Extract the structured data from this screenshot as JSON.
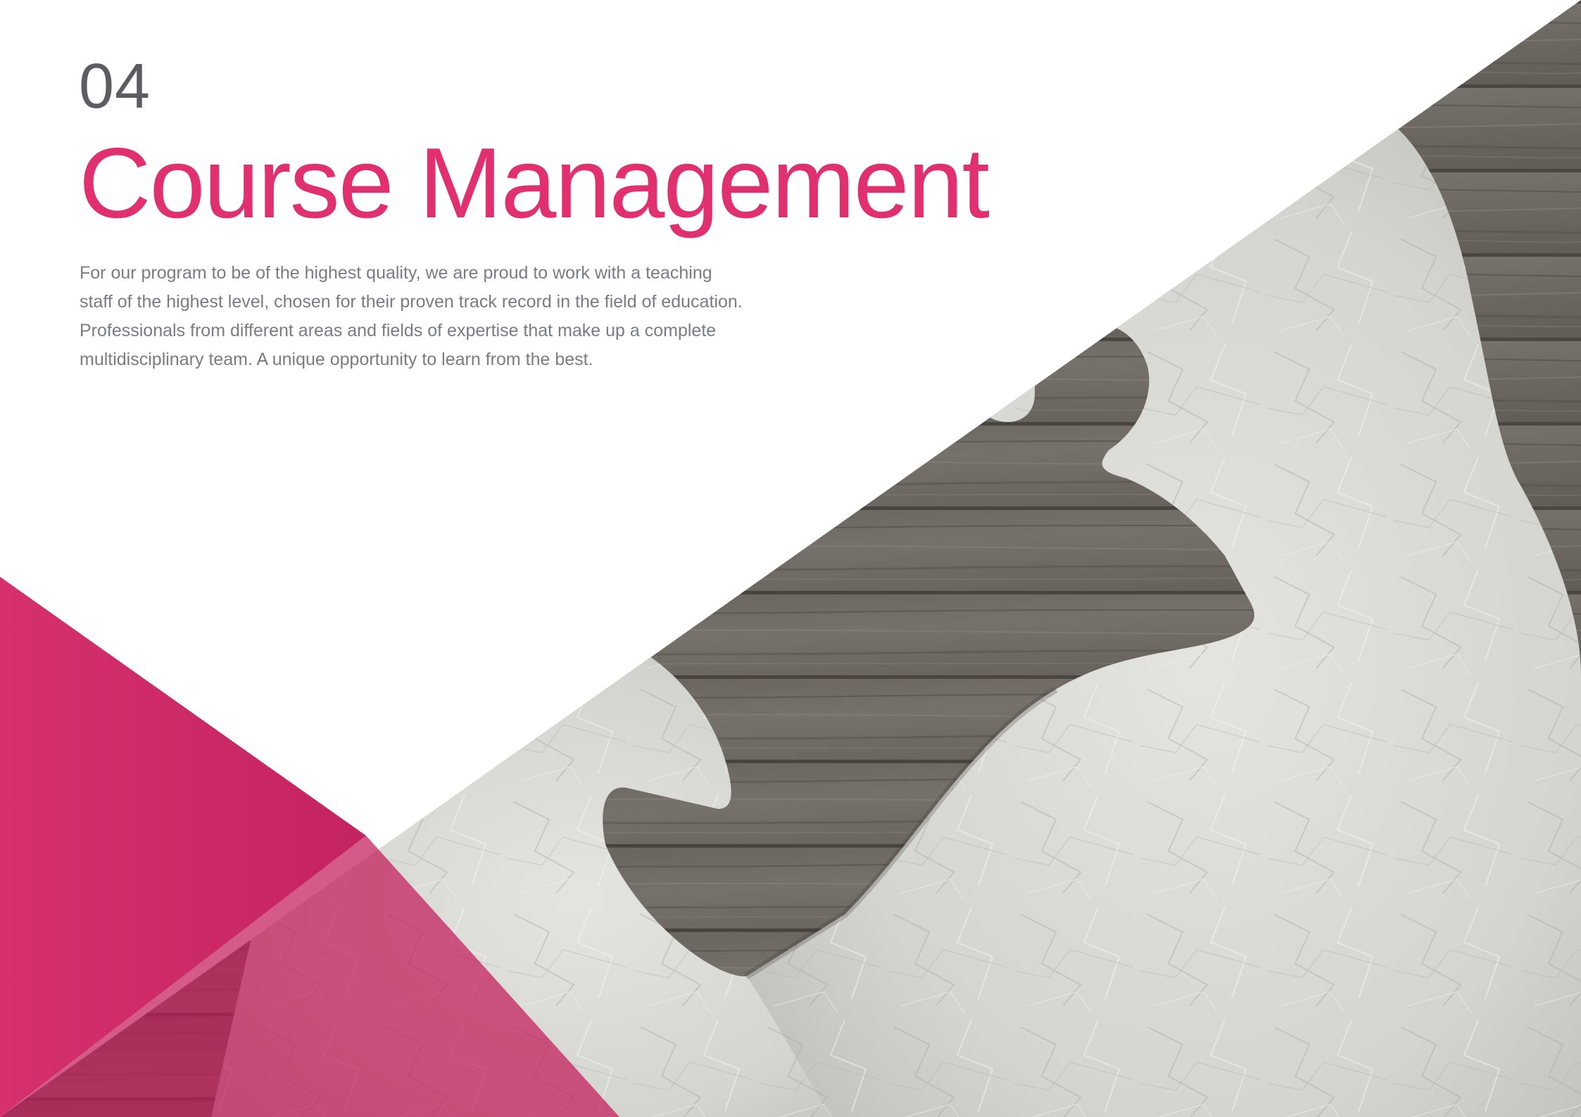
{
  "section": {
    "number": "04",
    "title": "Course Management"
  },
  "intro": {
    "lines": [
      "For our program to be of the highest quality, we are proud to work with a teaching",
      "staff of the highest level, chosen for their proven track record in the field of education.",
      "Professionals from different areas and fields of expertise that make up a complete",
      "multidisciplinary team. A unique opportunity to learn from the best."
    ]
  },
  "colors": {
    "accent": "#e0306f",
    "accent_dark": "#b81f57",
    "heading_number": "#5b5d62",
    "body_text": "#7a7c80",
    "wood": "#6e6a64",
    "paper": "#d6d6d2"
  },
  "image": {
    "subject": "crumpled-paper-puzzle-pieces-on-wood"
  }
}
